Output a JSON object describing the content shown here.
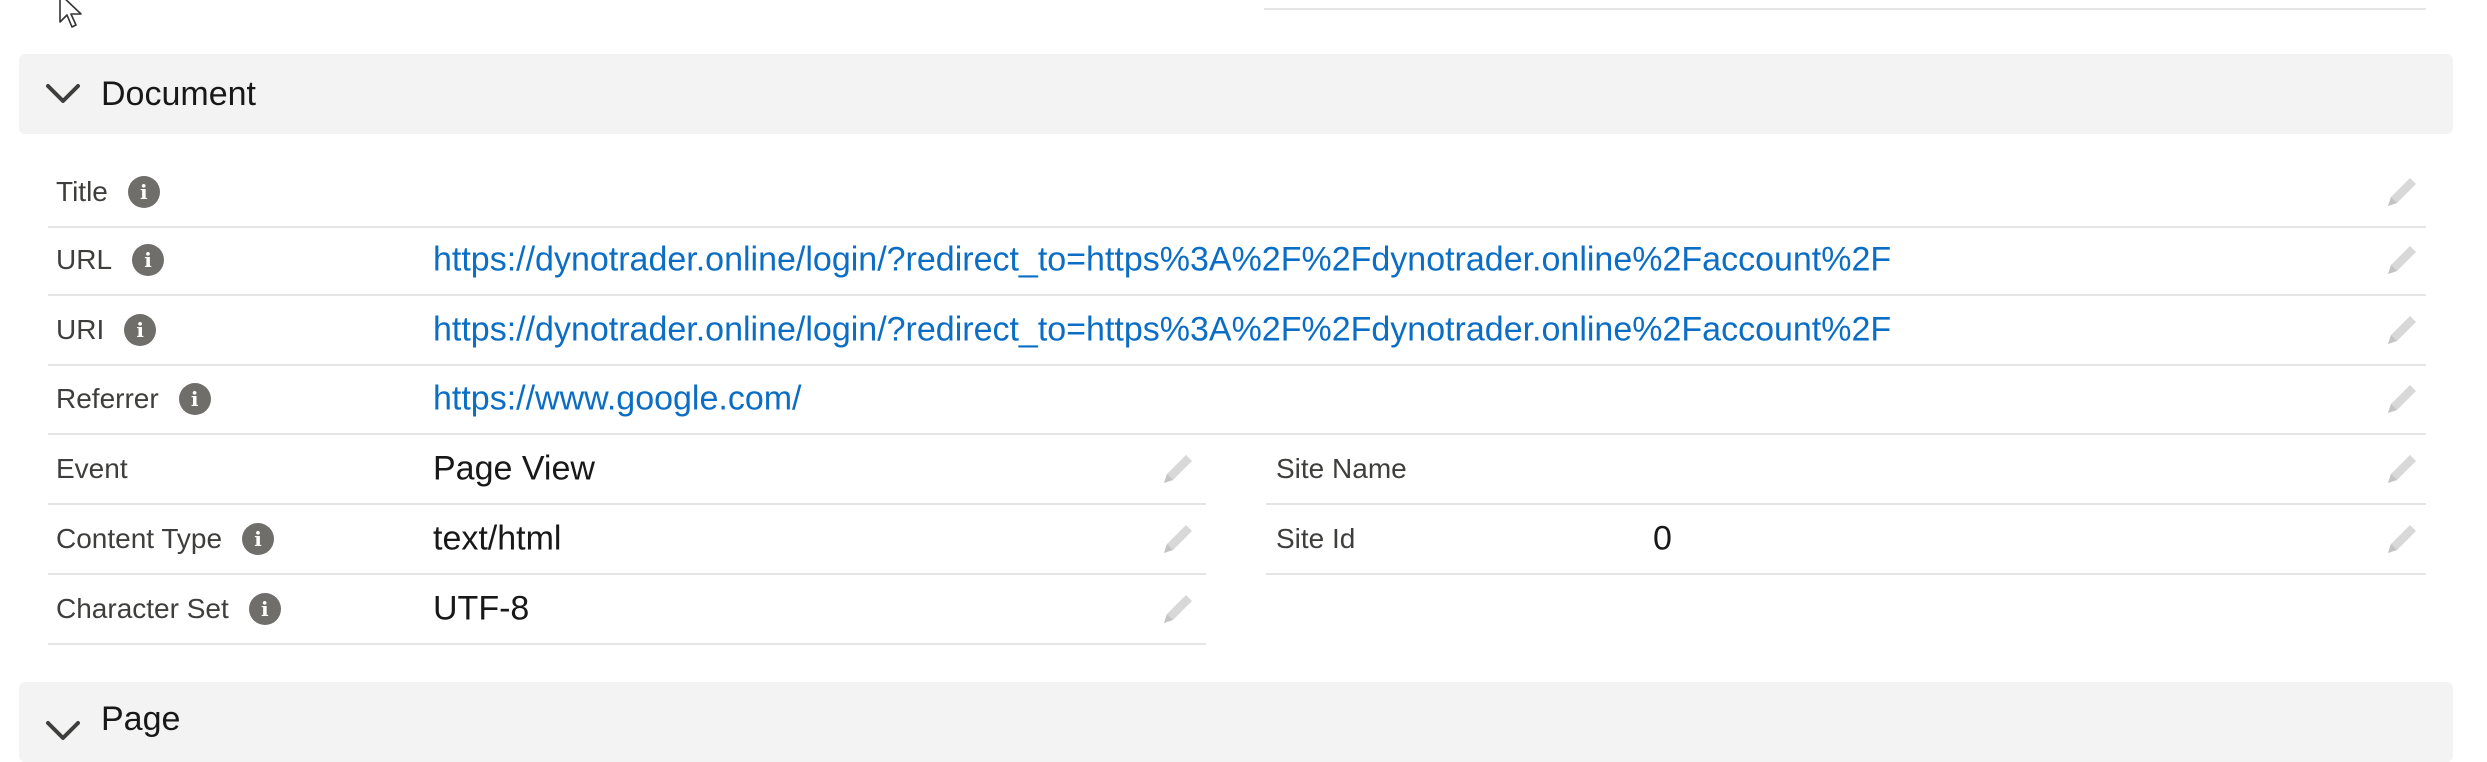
{
  "colors": {
    "link": "#0b6ec4",
    "header_bg": "#f3f3f3",
    "divider": "#e5e5e5",
    "info_icon": "#706e6b"
  },
  "sections": {
    "document": {
      "title": "Document",
      "fields": {
        "title": {
          "label": "Title",
          "value": ""
        },
        "url": {
          "label": "URL",
          "value": "https://dynotrader.online/login/?redirect_to=https%3A%2F%2Fdynotrader.online%2Faccount%2F"
        },
        "uri": {
          "label": "URI",
          "value": "https://dynotrader.online/login/?redirect_to=https%3A%2F%2Fdynotrader.online%2Faccount%2F"
        },
        "referrer": {
          "label": "Referrer",
          "value": "https://www.google.com/"
        },
        "event": {
          "label": "Event",
          "value": "Page View"
        },
        "content_type": {
          "label": "Content Type",
          "value": "text/html"
        },
        "character_set": {
          "label": "Character Set",
          "value": "UTF-8"
        },
        "site_name": {
          "label": "Site Name",
          "value": ""
        },
        "site_id": {
          "label": "Site Id",
          "value": "0"
        }
      }
    },
    "page": {
      "title": "Page"
    }
  },
  "icons": {
    "info": "info-icon",
    "edit": "pencil-icon",
    "collapse": "chevron-down-icon",
    "cursor": "mouse-pointer-icon"
  }
}
